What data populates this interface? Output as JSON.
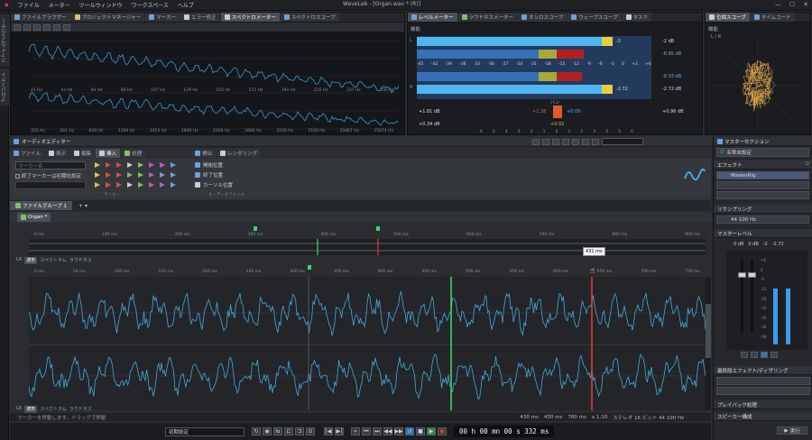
{
  "menu": {
    "items": [
      "ファイル",
      "メーター",
      "ツールウィンドウ",
      "ワークスペース",
      "ヘルプ"
    ],
    "window_title": "WaveLab - [Organ.wav * (R)]"
  },
  "left_vtabs": [
    "ファイルブラウザー",
    "プロジェクト"
  ],
  "top_left_tabs": [
    "ファイルブラウザー",
    "プロジェクトマネージャー",
    "マーカー",
    "エラー修正",
    "スペクトロメーター",
    "スペクトロスコープ"
  ],
  "spectro_freqs": [
    "21 Hz",
    "43 Hz",
    "64 Hz",
    "86 Hz",
    "107 Hz",
    "129 Hz",
    "150 Hz",
    "172 Hz",
    "194 Hz",
    "215 Hz",
    "237 Hz",
    "258 Hz"
  ],
  "spectro_freqs2": [
    "355 Hz",
    "581 Hz",
    "839 Hz",
    "1109 Hz",
    "1453 Hz",
    "1840 Hz",
    "2260 Hz",
    "2680 Hz",
    "3100 Hz",
    "5169 Hz",
    "10467 Hz",
    "15074 Hz"
  ],
  "level_tabs": [
    "レベルメーター",
    "ラウドネスメーター",
    "オシロスコープ",
    "ウェーブスコープ",
    "タスク"
  ],
  "level": {
    "preset_label": "機能",
    "peak_l": "-2",
    "peak_l_db": "-2 dB",
    "rms_l": "-8.85 dB",
    "rms_r": "-9.33 dB",
    "peak_r": "-2.72",
    "peak_r_db": "-2.72 dB",
    "scale": [
      "-45",
      "-42",
      "-39",
      "-36",
      "-33",
      "-30",
      "-27",
      "-24",
      "-21",
      "-18",
      "-15",
      "-12",
      "-9",
      "-6",
      "-3",
      "0",
      "+3",
      "+6"
    ],
    "balance_label": "バン",
    "val_left_top": "+1.81 dB",
    "val_left_bot": "+0.34 dB",
    "val_mid_red": "+1.28",
    "val_mid_blue": "+0.09",
    "val_mid_bot": "+0.02",
    "val_right": "+0.96 dB",
    "pan_scale": [
      "6",
      "5",
      "4",
      "3",
      "2",
      "1",
      "0",
      "1",
      "2",
      "3",
      "4",
      "5",
      "6"
    ],
    "l_label": "L",
    "r_label": "R"
  },
  "scope_tabs": [
    "位相スコープ",
    "タイムコード"
  ],
  "scope": {
    "preset": "機能",
    "label": "L / R"
  },
  "audio_editor": {
    "title": "オーディオエディター",
    "tabs": [
      "ファイル",
      "表示",
      "編集",
      "挿入",
      "処理",
      "検出",
      "レンダリング"
    ],
    "ribbon": {
      "marker_name_placeholder": "マーカー名",
      "check_end_marker": "終了マーカーは初期化設定",
      "group1_label": "マーカー",
      "start_pos": "開始位置",
      "end_pos": "終了位置",
      "cursor_pos": "カーソル位置",
      "group2_label": "オーディオファイル"
    },
    "file_group": "ファイルグループ 1",
    "file_tab": "Organ *",
    "overview_ruler": [
      "0 ms",
      "100 ms",
      "200 ms",
      "300 ms",
      "400 ms",
      "500 ms",
      "600 ms",
      "700 ms",
      "800 ms",
      "900 ms"
    ],
    "main_ruler": [
      "0 ms",
      "50 ms",
      "100 ms",
      "150 ms",
      "200 ms",
      "250 ms",
      "300 ms",
      "350 ms",
      "400 ms",
      "450 ms",
      "500 ms",
      "550 ms",
      "600 ms",
      "650 ms",
      "700 ms",
      "750 ms"
    ],
    "view_tabs_top": [
      "LR",
      "波形",
      "スペクトラム",
      "ラウドネス"
    ],
    "view_tabs_bot": [
      "LR",
      "波形",
      "スペクトラム",
      "ラウドネス"
    ],
    "tooltip": "431 ms",
    "status_hint": "マーカーを移動します。ドラッグで移動",
    "sel_start": "430 ms",
    "sel_len": "430 ms",
    "sel_end": "780 ms",
    "zoom": "x 1:10",
    "format": "ステレオ 16 ビット 44 100 Hz"
  },
  "transport": {
    "preset": "初期設定",
    "time": "00 h 00 mn 00 s 332 ms"
  },
  "master": {
    "title": "マスターセクション",
    "preset": "名称未設定",
    "effects_label": "エフェクト",
    "effect_slot": "MasterRig",
    "resample_label": "リサンプリング",
    "resample_value": "44 100 Hz",
    "master_level_label": "マスターレベル",
    "db_left": "0 dB",
    "db_right": "0 dB",
    "peak_l": "-2",
    "peak_r": "-2.72",
    "fader_scale": [
      "+6",
      "0",
      "-6",
      "-12",
      "-18",
      "-24",
      "-30",
      "-36",
      "-48"
    ],
    "final_fx_label": "最終段エフェクト/ディザリング",
    "playback_label": "プレイバック処理",
    "speaker_label": "スピーカー構成",
    "render_btn": "実行",
    "colors": {
      "meter_blue": "#3a9bf0",
      "accent_green": "#3fd46b",
      "accent_red": "#e03a3a"
    }
  }
}
